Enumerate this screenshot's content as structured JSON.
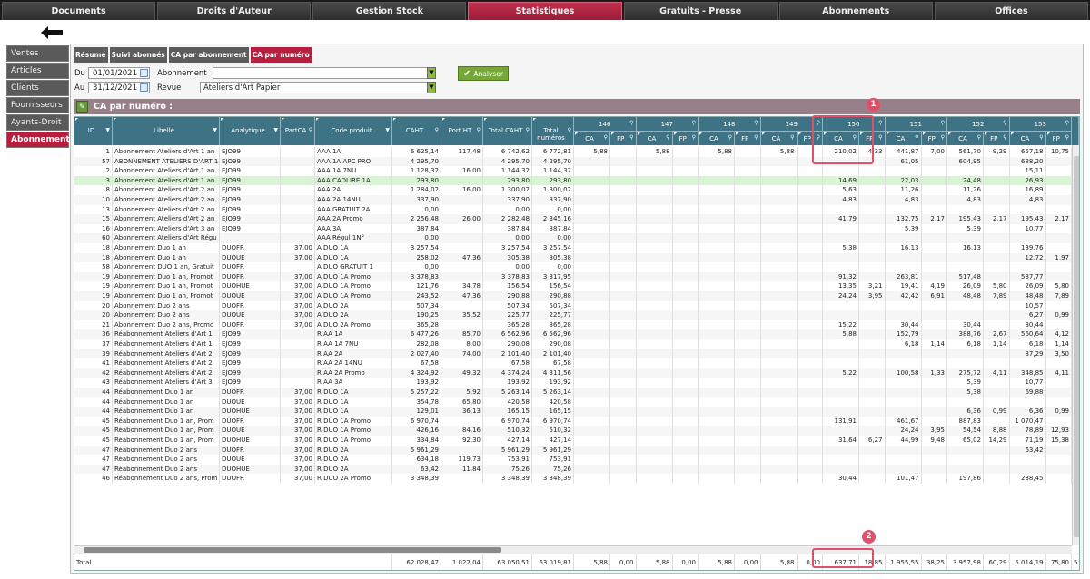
{
  "nav": {
    "tabs": [
      "Documents",
      "Droits d'Auteur",
      "Gestion Stock",
      "Statistiques",
      "Gratuits - Presse",
      "Abonnements",
      "Offices"
    ],
    "active": 3
  },
  "sidebar": {
    "items": [
      "Ventes",
      "Articles",
      "Clients",
      "Fournisseurs",
      "Ayants-Droit",
      "Abonnements"
    ],
    "active": 5
  },
  "subtabs": {
    "items": [
      "Résumé",
      "Suivi abonnés",
      "CA par abonnement",
      "CA par numéro"
    ],
    "active": 3
  },
  "filters": {
    "du_label": "Du",
    "au_label": "Au",
    "date_from": "01/01/2021",
    "date_to": "31/12/2021",
    "abonnement_label": "Abonnement",
    "revue_label": "Revue",
    "abonnement_value": "",
    "revue_value": "Ateliers d'Art Papier",
    "analyser_label": "Analyser"
  },
  "section_title": "CA par numéro :",
  "headers": {
    "id": "ID",
    "libelle": "Libellé",
    "analytique": "Analytique",
    "partca": "PartCA",
    "code": "Code produit",
    "caht": "CAHT",
    "port": "Port HT",
    "total_caht": "Total CAHT",
    "total_num": "Total numéros",
    "issues": [
      "146",
      "147",
      "148",
      "149",
      "150",
      "151",
      "152",
      "153"
    ],
    "ca": "CA",
    "fp": "FP"
  },
  "rows": [
    [
      "1",
      "Abonnement Ateliers d'Art 1 an",
      "EJO99",
      "",
      "AAA 1A",
      "6 625,14",
      "117,48",
      "6 742,62",
      "6 772,81",
      [
        "5,88",
        "",
        "5,88",
        "",
        "5,88",
        "",
        "5,88",
        "",
        "210,02",
        "4,33",
        "441,87",
        "7,00",
        "561,70",
        "9,29",
        "657,18",
        "10,75"
      ]
    ],
    [
      "57",
      "ABONNEMENT ATELIERS D'ART 1",
      "EJO99",
      "",
      "AAA 1A APC PRO",
      "4 295,70",
      "",
      "4 295,70",
      "4 295,70",
      [
        "",
        "",
        "",
        "",
        "",
        "",
        "",
        "",
        "",
        "",
        "61,05",
        "",
        "604,95",
        "",
        "688,20",
        ""
      ]
    ],
    [
      "2",
      "Abonnement Ateliers d'Art 1 an",
      "EJO99",
      "",
      "AAA 1A 7NU",
      "1 128,32",
      "16,00",
      "1 144,32",
      "1 144,32",
      [
        "",
        "",
        "",
        "",
        "",
        "",
        "",
        "",
        "",
        "",
        "",
        "",
        "",
        "",
        "15,11",
        ""
      ]
    ],
    [
      "3",
      "Abonnement Ateliers d'Art 1 an",
      "EJO99",
      "",
      "AAA CADLIRE 1A",
      "293,80",
      "",
      "293,80",
      "293,80",
      [
        "",
        "",
        "",
        "",
        "",
        "",
        "",
        "",
        "14,69",
        "",
        "22,03",
        "",
        "24,48",
        "",
        "26,93",
        ""
      ]
    ],
    [
      "8",
      "Abonnement Ateliers d'Art 2 an",
      "EJO99",
      "",
      "AAA 2A",
      "1 284,02",
      "16,00",
      "1 300,02",
      "1 300,02",
      [
        "",
        "",
        "",
        "",
        "",
        "",
        "",
        "",
        "5,63",
        "",
        "11,26",
        "",
        "11,26",
        "",
        "16,89",
        ""
      ]
    ],
    [
      "10",
      "Abonnement Ateliers d'Art 2 an",
      "EJO99",
      "",
      "AAA 2A 14NU",
      "337,90",
      "",
      "337,90",
      "337,90",
      [
        "",
        "",
        "",
        "",
        "",
        "",
        "",
        "",
        "4,83",
        "",
        "4,83",
        "",
        "4,83",
        "",
        "4,83",
        ""
      ]
    ],
    [
      "13",
      "Abonnement Ateliers d'Art 2 an",
      "EJO99",
      "",
      "AAA GRATUIT 2A",
      "0,00",
      "",
      "0,00",
      "0,00",
      [
        "",
        "",
        "",
        "",
        "",
        "",
        "",
        "",
        "",
        "",
        "",
        "",
        "",
        "",
        "",
        ""
      ]
    ],
    [
      "15",
      "Abonnement Ateliers d'Art 2 an",
      "EJO99",
      "",
      "AAA 2A Promo",
      "2 256,48",
      "26,00",
      "2 282,48",
      "2 345,16",
      [
        "",
        "",
        "",
        "",
        "",
        "",
        "",
        "",
        "41,79",
        "",
        "132,75",
        "2,17",
        "195,43",
        "2,17",
        "195,43",
        "2,17"
      ]
    ],
    [
      "16",
      "Abonnement Ateliers d'Art 3 an",
      "EJO99",
      "",
      "AAA 3A",
      "387,84",
      "",
      "387,84",
      "387,84",
      [
        "",
        "",
        "",
        "",
        "",
        "",
        "",
        "",
        "",
        "",
        "5,39",
        "",
        "5,39",
        "",
        "10,77",
        ""
      ]
    ],
    [
      "60",
      "Abonnement Ateliers d'Art Régu",
      "",
      "",
      "AAA Régul 1N°",
      "0,00",
      "",
      "0,00",
      "0,00",
      [
        "",
        "",
        "",
        "",
        "",
        "",
        "",
        "",
        "",
        "",
        "",
        "",
        "",
        "",
        "",
        ""
      ]
    ],
    [
      "18",
      "Abonnement Duo 1 an",
      "DUOFR",
      "37,00",
      "A DUO 1A",
      "3 257,54",
      "",
      "3 257,54",
      "3 257,54",
      [
        "",
        "",
        "",
        "",
        "",
        "",
        "",
        "",
        "5,38",
        "",
        "16,13",
        "",
        "16,13",
        "",
        "139,76",
        ""
      ]
    ],
    [
      "18",
      "Abonnement Duo 1 an",
      "DUOUE",
      "37,00",
      "A DUO 1A",
      "258,02",
      "47,36",
      "305,38",
      "305,38",
      [
        "",
        "",
        "",
        "",
        "",
        "",
        "",
        "",
        "",
        "",
        "",
        "",
        "",
        "",
        "12,72",
        "1,97"
      ]
    ],
    [
      "58",
      "Abonnement DUO 1 an, Gratuit",
      "DUOFR",
      "",
      "A DUO GRATUIT 1",
      "0,00",
      "",
      "0,00",
      "0,00",
      [
        "",
        "",
        "",
        "",
        "",
        "",
        "",
        "",
        "",
        "",
        "",
        "",
        "",
        "",
        "",
        ""
      ]
    ],
    [
      "19",
      "Abonnement Duo 1 an, Promot",
      "DUOFR",
      "37,00",
      "A DUO 1A Promo",
      "3 378,83",
      "",
      "3 378,83",
      "3 317,95",
      [
        "",
        "",
        "",
        "",
        "",
        "",
        "",
        "",
        "91,32",
        "",
        "263,81",
        "",
        "517,48",
        "",
        "537,77",
        ""
      ]
    ],
    [
      "19",
      "Abonnement Duo 1 an, Promot",
      "DUOHUE",
      "37,00",
      "A DUO 1A Promo",
      "121,76",
      "34,78",
      "156,54",
      "156,54",
      [
        "",
        "",
        "",
        "",
        "",
        "",
        "",
        "",
        "13,35",
        "3,21",
        "19,41",
        "4,19",
        "26,09",
        "5,80",
        "26,09",
        "5,80"
      ]
    ],
    [
      "19",
      "Abonnement Duo 1 an, Promot",
      "DUOUE",
      "37,00",
      "A DUO 1A Promo",
      "243,52",
      "47,36",
      "290,88",
      "290,88",
      [
        "",
        "",
        "",
        "",
        "",
        "",
        "",
        "",
        "24,24",
        "3,95",
        "42,42",
        "6,91",
        "48,48",
        "7,89",
        "48,48",
        "7,89"
      ]
    ],
    [
      "20",
      "Abonnement Duo 2 ans",
      "DUOFR",
      "37,00",
      "A DUO 2A",
      "507,34",
      "",
      "507,34",
      "507,34",
      [
        "",
        "",
        "",
        "",
        "",
        "",
        "",
        "",
        "",
        "",
        "",
        "",
        "",
        "",
        "10,57",
        ""
      ]
    ],
    [
      "20",
      "Abonnement Duo 2 ans",
      "DUOUE",
      "37,00",
      "A DUO 2A",
      "190,25",
      "35,52",
      "225,77",
      "225,77",
      [
        "",
        "",
        "",
        "",
        "",
        "",
        "",
        "",
        "",
        "",
        "",
        "",
        "",
        "",
        "6,27",
        "0,99"
      ]
    ],
    [
      "21",
      "Abonnement Duo 2 ans, Promo",
      "DUOFR",
      "37,00",
      "A DUO 2A Promo",
      "365,28",
      "",
      "365,28",
      "365,28",
      [
        "",
        "",
        "",
        "",
        "",
        "",
        "",
        "",
        "15,22",
        "",
        "30,44",
        "",
        "30,44",
        "",
        "30,44",
        ""
      ]
    ],
    [
      "36",
      "Réabonnement Ateliers d'Art 1",
      "EJO99",
      "",
      "R AA 1A",
      "6 477,26",
      "85,70",
      "6 562,96",
      "6 562,96",
      [
        "",
        "",
        "",
        "",
        "",
        "",
        "",
        "",
        "5,88",
        "",
        "152,79",
        "",
        "388,76",
        "2,67",
        "560,64",
        "4,12"
      ]
    ],
    [
      "37",
      "Réabonnement Ateliers d'Art 1",
      "EJO99",
      "",
      "R AA 1A 7NU",
      "282,08",
      "8,00",
      "290,08",
      "290,08",
      [
        "",
        "",
        "",
        "",
        "",
        "",
        "",
        "",
        "",
        "",
        "6,18",
        "1,14",
        "6,18",
        "1,14",
        "6,18",
        "1,14"
      ]
    ],
    [
      "39",
      "Réabonnement Ateliers d'Art 2",
      "EJO99",
      "",
      "R AA 2A",
      "2 027,40",
      "74,00",
      "2 101,40",
      "2 101,40",
      [
        "",
        "",
        "",
        "",
        "",
        "",
        "",
        "",
        "",
        "",
        "",
        "",
        "",
        "",
        "37,29",
        "3,50"
      ]
    ],
    [
      "41",
      "Réabonnement Ateliers d'Art 2",
      "EJO99",
      "",
      "R AA 2A 14NU",
      "67,58",
      "",
      "67,58",
      "67,58",
      [
        "",
        "",
        "",
        "",
        "",
        "",
        "",
        "",
        "",
        "",
        "",
        "",
        "",
        "",
        "",
        ""
      ]
    ],
    [
      "42",
      "Réabonnement Ateliers d'Art 2",
      "EJO99",
      "",
      "R AA 2A Promo",
      "4 324,92",
      "49,32",
      "4 374,24",
      "4 311,56",
      [
        "",
        "",
        "",
        "",
        "",
        "",
        "",
        "",
        "5,22",
        "",
        "100,58",
        "1,33",
        "275,72",
        "4,11",
        "348,85",
        "4,11"
      ]
    ],
    [
      "43",
      "Réabonnement Ateliers d'Art 3",
      "EJO99",
      "",
      "R AA 3A",
      "193,92",
      "",
      "193,92",
      "193,92",
      [
        "",
        "",
        "",
        "",
        "",
        "",
        "",
        "",
        "",
        "",
        "",
        "",
        "5,39",
        "",
        "10,77",
        ""
      ]
    ],
    [
      "44",
      "Réabonnement Duo 1 an",
      "DUOFR",
      "37,00",
      "R DUO 1A",
      "5 257,22",
      "5,92",
      "5 263,14",
      "5 263,14",
      [
        "",
        "",
        "",
        "",
        "",
        "",
        "",
        "",
        "",
        "",
        "",
        "",
        "5,38",
        "",
        "69,88",
        ""
      ]
    ],
    [
      "44",
      "Réabonnement Duo 1 an",
      "DUOUE",
      "37,00",
      "R DUO 1A",
      "354,78",
      "65,80",
      "420,58",
      "420,58",
      [
        "",
        "",
        "",
        "",
        "",
        "",
        "",
        "",
        "",
        "",
        "",
        "",
        "",
        "",
        "",
        ""
      ]
    ],
    [
      "44",
      "Réabonnement Duo 1 an",
      "DUOHUE",
      "37,00",
      "R DUO 1A",
      "129,01",
      "36,13",
      "165,15",
      "165,15",
      [
        "",
        "",
        "",
        "",
        "",
        "",
        "",
        "",
        "",
        "",
        "",
        "",
        "6,36",
        "0,99",
        "6,36",
        "0,99"
      ]
    ],
    [
      "45",
      "Réabonnement Duo 1 an, Prom",
      "DUOFR",
      "37,00",
      "R DUO 1A Promo",
      "6 970,74",
      "",
      "6 970,74",
      "6 970,74",
      [
        "",
        "",
        "",
        "",
        "",
        "",
        "",
        "",
        "131,91",
        "",
        "461,67",
        "",
        "887,83",
        "",
        "1 070,47",
        ""
      ]
    ],
    [
      "45",
      "Réabonnement Duo 1 an, Prom",
      "DUOUE",
      "37,00",
      "R DUO 1A Promo",
      "426,16",
      "84,16",
      "510,32",
      "510,32",
      [
        "",
        "",
        "",
        "",
        "",
        "",
        "",
        "",
        "",
        "",
        "24,24",
        "3,95",
        "54,54",
        "8,88",
        "78,89",
        "12,93"
      ]
    ],
    [
      "45",
      "Réabonnement Duo 1 an, Prom",
      "DUOHUE",
      "37,00",
      "R DUO 1A Promo",
      "334,84",
      "92,30",
      "427,14",
      "427,14",
      [
        "",
        "",
        "",
        "",
        "",
        "",
        "",
        "",
        "31,64",
        "6,27",
        "44,99",
        "9,48",
        "65,02",
        "14,29",
        "71,19",
        "15,38"
      ]
    ],
    [
      "47",
      "Réabonnement Duo 2 ans",
      "DUOFR",
      "37,00",
      "R DUO 2A",
      "5 961,29",
      "",
      "5 961,29",
      "5 961,29",
      [
        "",
        "",
        "",
        "",
        "",
        "",
        "",
        "",
        "",
        "",
        "",
        "",
        "",
        "",
        "63,42",
        ""
      ]
    ],
    [
      "47",
      "Réabonnement Duo 2 ans",
      "DUOUE",
      "37,00",
      "R DUO 2A",
      "634,18",
      "119,73",
      "753,91",
      "753,91",
      [
        "",
        "",
        "",
        "",
        "",
        "",
        "",
        "",
        "",
        "",
        "",
        "",
        "",
        "",
        "",
        ""
      ]
    ],
    [
      "47",
      "Réabonnement Duo 2 ans",
      "DUOHUE",
      "37,00",
      "R DUO 2A",
      "63,42",
      "11,84",
      "75,26",
      "75,26",
      [
        "",
        "",
        "",
        "",
        "",
        "",
        "",
        "",
        "",
        "",
        "",
        "",
        "",
        "",
        "",
        ""
      ]
    ],
    [
      "46",
      "Réabonnement Duo 2 ans, Prom",
      "DUOFR",
      "37,00",
      "R DUO 2A Promo",
      "3 348,39",
      "",
      "3 348,39",
      "3 348,39",
      [
        "",
        "",
        "",
        "",
        "",
        "",
        "",
        "",
        "30,44",
        "",
        "101,47",
        "",
        "197,86",
        "",
        "238,45",
        ""
      ]
    ]
  ],
  "total": {
    "label": "Total",
    "caht": "62 028,47",
    "port": "1 022,04",
    "total_caht": "63 050,51",
    "total_num": "63 019,81",
    "issues": [
      "5,88",
      "0,00",
      "5,88",
      "0,00",
      "5,88",
      "0,00",
      "5,88",
      "0,00",
      "637,71",
      "18,85",
      "1 955,55",
      "38,25",
      "3 957,98",
      "60,29",
      "5 014,19",
      "75,80"
    ],
    "overflow": "5 94"
  },
  "badges": [
    "1",
    "2"
  ],
  "extra_col_value": "1",
  "colors": {
    "accent": "#b71f3e",
    "header": "#3d7385",
    "highlight_box": "#e0506a",
    "analyser": "#76a838"
  },
  "icons": {
    "back": "back-arrow-icon",
    "calendar": "calendar-icon",
    "filter": "filter-icon",
    "search": "search-icon",
    "check": "check-icon",
    "wrench": "wrench-icon"
  }
}
